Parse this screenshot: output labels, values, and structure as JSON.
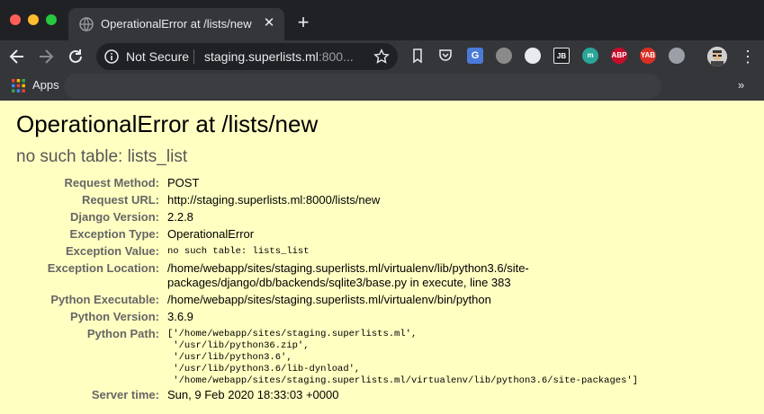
{
  "browser": {
    "tab": {
      "title": "OperationalError at /lists/new"
    },
    "omnibox": {
      "security": "Not Secure",
      "host": "staging.superlists.ml",
      "port": ":800..."
    },
    "extensions": [
      {
        "name": "google-translate-icon",
        "label": "G",
        "color": "#4a7bd8"
      },
      {
        "name": "gear-extension-icon",
        "label": "",
        "color": "#8a8a8a"
      },
      {
        "name": "diamond-extension-icon",
        "label": "",
        "color": "#e8eaed"
      },
      {
        "name": "jb-extension-icon",
        "label": "JB",
        "color": "#202124"
      },
      {
        "name": "m-extension-icon",
        "label": "m",
        "color": "#2aa59a"
      },
      {
        "name": "adblock-plus-icon",
        "label": "ABP",
        "color": "#c70d2c"
      },
      {
        "name": "yab-extension-icon",
        "label": "YAB",
        "color": "#d93025"
      },
      {
        "name": "google-drive-icon",
        "label": "",
        "color": "#9aa0a6"
      }
    ],
    "bookmarks": {
      "apps_label": "Apps",
      "more": "»"
    }
  },
  "page": {
    "title": "OperationalError at /lists/new",
    "subtitle": "no such table: lists_list",
    "rows": [
      {
        "label": "Request Method:",
        "value": "POST",
        "mono": false
      },
      {
        "label": "Request URL:",
        "value": "http://staging.superlists.ml:8000/lists/new",
        "mono": false
      },
      {
        "label": "Django Version:",
        "value": "2.2.8",
        "mono": false
      },
      {
        "label": "Exception Type:",
        "value": "OperationalError",
        "mono": false
      },
      {
        "label": "Exception Value:",
        "value": "no such table: lists_list",
        "mono": true
      },
      {
        "label": "Exception Location:",
        "value": "/home/webapp/sites/staging.superlists.ml/virtualenv/lib/python3.6/site-\npackages/django/db/backends/sqlite3/base.py in execute, line 383",
        "mono": false
      },
      {
        "label": "Python Executable:",
        "value": "/home/webapp/sites/staging.superlists.ml/virtualenv/bin/python",
        "mono": false
      },
      {
        "label": "Python Version:",
        "value": "3.6.9",
        "mono": false
      },
      {
        "label": "Python Path:",
        "value": "['/home/webapp/sites/staging.superlists.ml',\n '/usr/lib/python36.zip',\n '/usr/lib/python3.6',\n '/usr/lib/python3.6/lib-dynload',\n '/home/webapp/sites/staging.superlists.ml/virtualenv/lib/python3.6/site-packages']",
        "mono": true
      },
      {
        "label": "Server time:",
        "value": "Sun, 9 Feb 2020 18:33:03 +0000",
        "mono": false
      }
    ]
  }
}
